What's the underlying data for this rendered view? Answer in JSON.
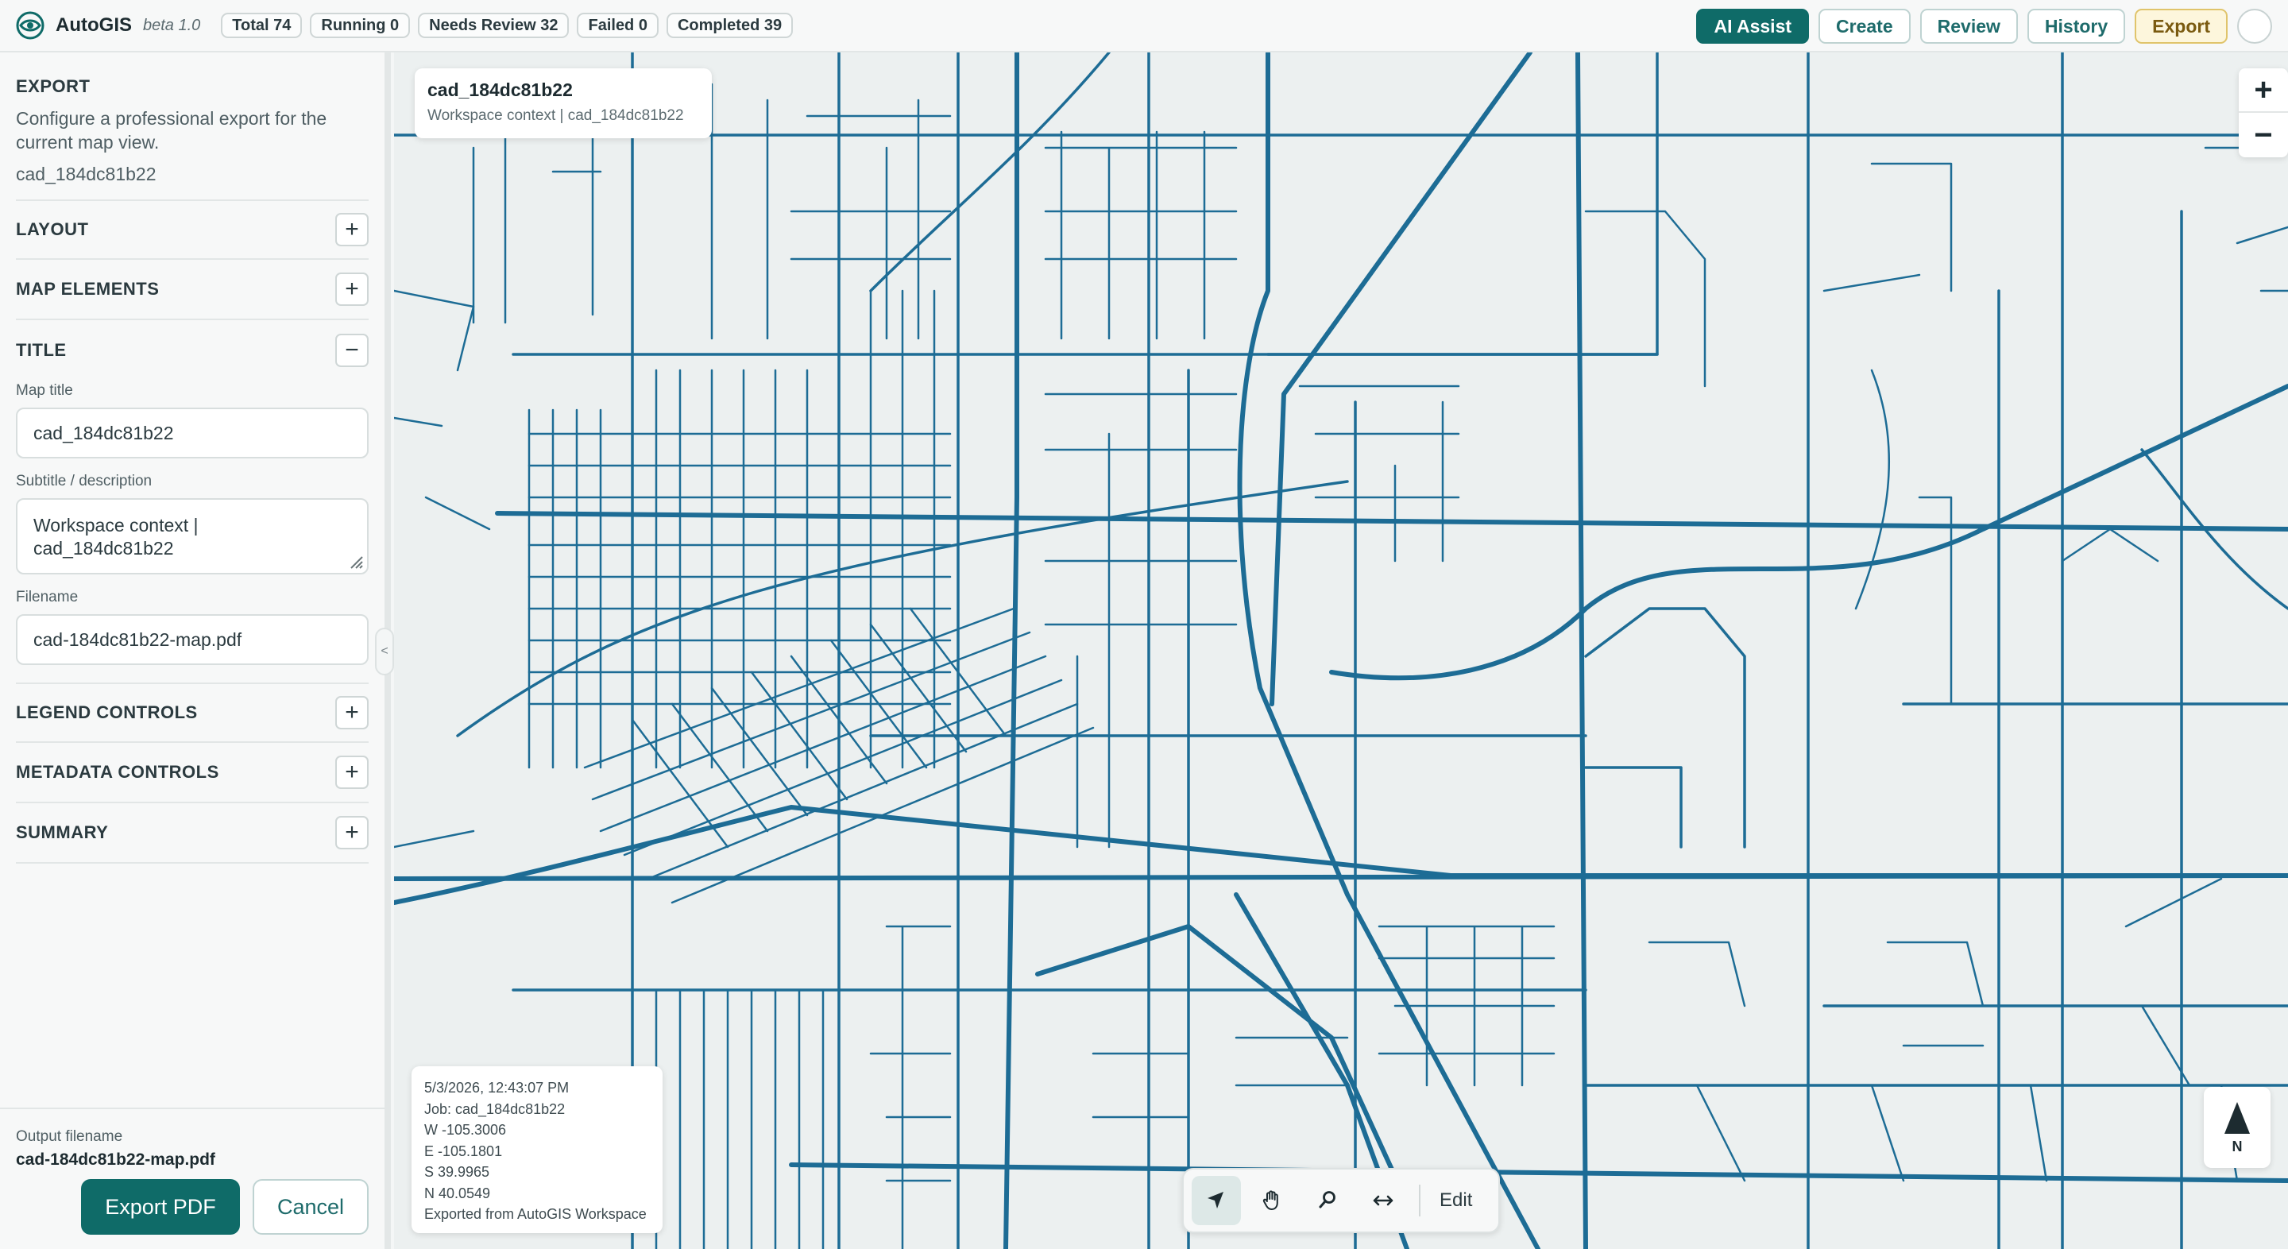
{
  "app": {
    "name": "AutoGIS",
    "version": "beta 1.0",
    "logo_icon": "autogis-logo-icon"
  },
  "stats": [
    {
      "label": "Total 74"
    },
    {
      "label": "Running 0"
    },
    {
      "label": "Needs Review 32"
    },
    {
      "label": "Failed 0"
    },
    {
      "label": "Completed 39"
    }
  ],
  "nav": {
    "ai_assist": "AI Assist",
    "create": "Create",
    "review": "Review",
    "history": "History",
    "export": "Export"
  },
  "sidebar": {
    "heading": "EXPORT",
    "description": "Configure a professional export for the current map view.",
    "job_id": "cad_184dc81b22",
    "sections": {
      "layout": "LAYOUT",
      "map_elements": "MAP ELEMENTS",
      "title": "TITLE",
      "legend_controls": "LEGEND CONTROLS",
      "metadata_controls": "METADATA CONTROLS",
      "summary": "SUMMARY"
    },
    "expand_symbol": "+",
    "collapse_symbol": "−",
    "title_fields": {
      "map_title_label": "Map title",
      "map_title_value": "cad_184dc81b22",
      "subtitle_label": "Subtitle / description",
      "subtitle_line1": "Workspace context |",
      "subtitle_line2": "cad_184dc81b22",
      "filename_label": "Filename",
      "filename_value": "cad-184dc81b22-map.pdf"
    },
    "footer": {
      "output_label": "Output filename",
      "output_value": "cad-184dc81b22-map.pdf",
      "export_button": "Export PDF",
      "cancel_button": "Cancel"
    },
    "collapse_handle": "<"
  },
  "map": {
    "context_card": {
      "title": "cad_184dc81b22",
      "subtitle": "Workspace context | cad_184dc81b22"
    },
    "zoom_in": "+",
    "zoom_out": "−",
    "metadata": {
      "timestamp": "5/3/2026, 12:43:07 PM",
      "job": "Job: cad_184dc81b22",
      "west": "W -105.3006",
      "east": "E -105.1801",
      "south": "S 39.9965",
      "north": "N 40.0549",
      "credit": "Exported from AutoGIS Workspace"
    },
    "toolbar": {
      "edit": "Edit"
    },
    "north_label": "N",
    "road_color": "#1d6c95"
  },
  "colors": {
    "accent": "#0f6b68",
    "export_active_bg": "#fdf6dc",
    "road": "#1d6c95"
  }
}
